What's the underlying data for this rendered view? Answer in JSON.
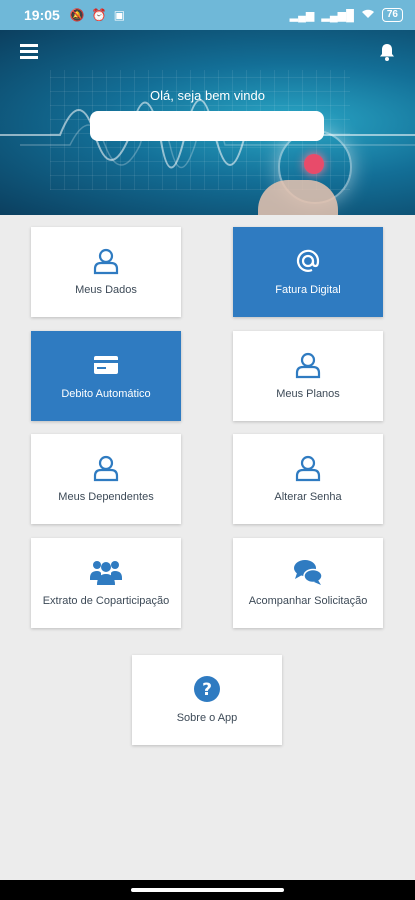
{
  "status_bar": {
    "time": "19:05",
    "battery": "76"
  },
  "header": {
    "welcome": "Olá, seja bem vindo",
    "menu_icon": "hamburger-menu-icon",
    "bell_icon": "bell-icon"
  },
  "tiles": [
    {
      "label": "Meus Dados",
      "icon": "user-icon"
    },
    {
      "label": "Fatura Digital",
      "icon": "at-sign-icon"
    },
    {
      "label": "Debito Automático",
      "icon": "credit-card-icon"
    },
    {
      "label": "Meus Planos",
      "icon": "user-icon"
    },
    {
      "label": "Meus Dependentes",
      "icon": "user-icon"
    },
    {
      "label": "Alterar Senha",
      "icon": "user-icon"
    },
    {
      "label": "Extrato de Coparticipação",
      "icon": "group-icon"
    },
    {
      "label": "Acompanhar Solicitação",
      "icon": "chat-bubbles-icon"
    },
    {
      "label": "Sobre o App",
      "icon": "help-circle-icon"
    }
  ],
  "colors": {
    "accent": "#2f7bc1",
    "status_bar": "#6fb8d8",
    "background": "#ececec"
  }
}
